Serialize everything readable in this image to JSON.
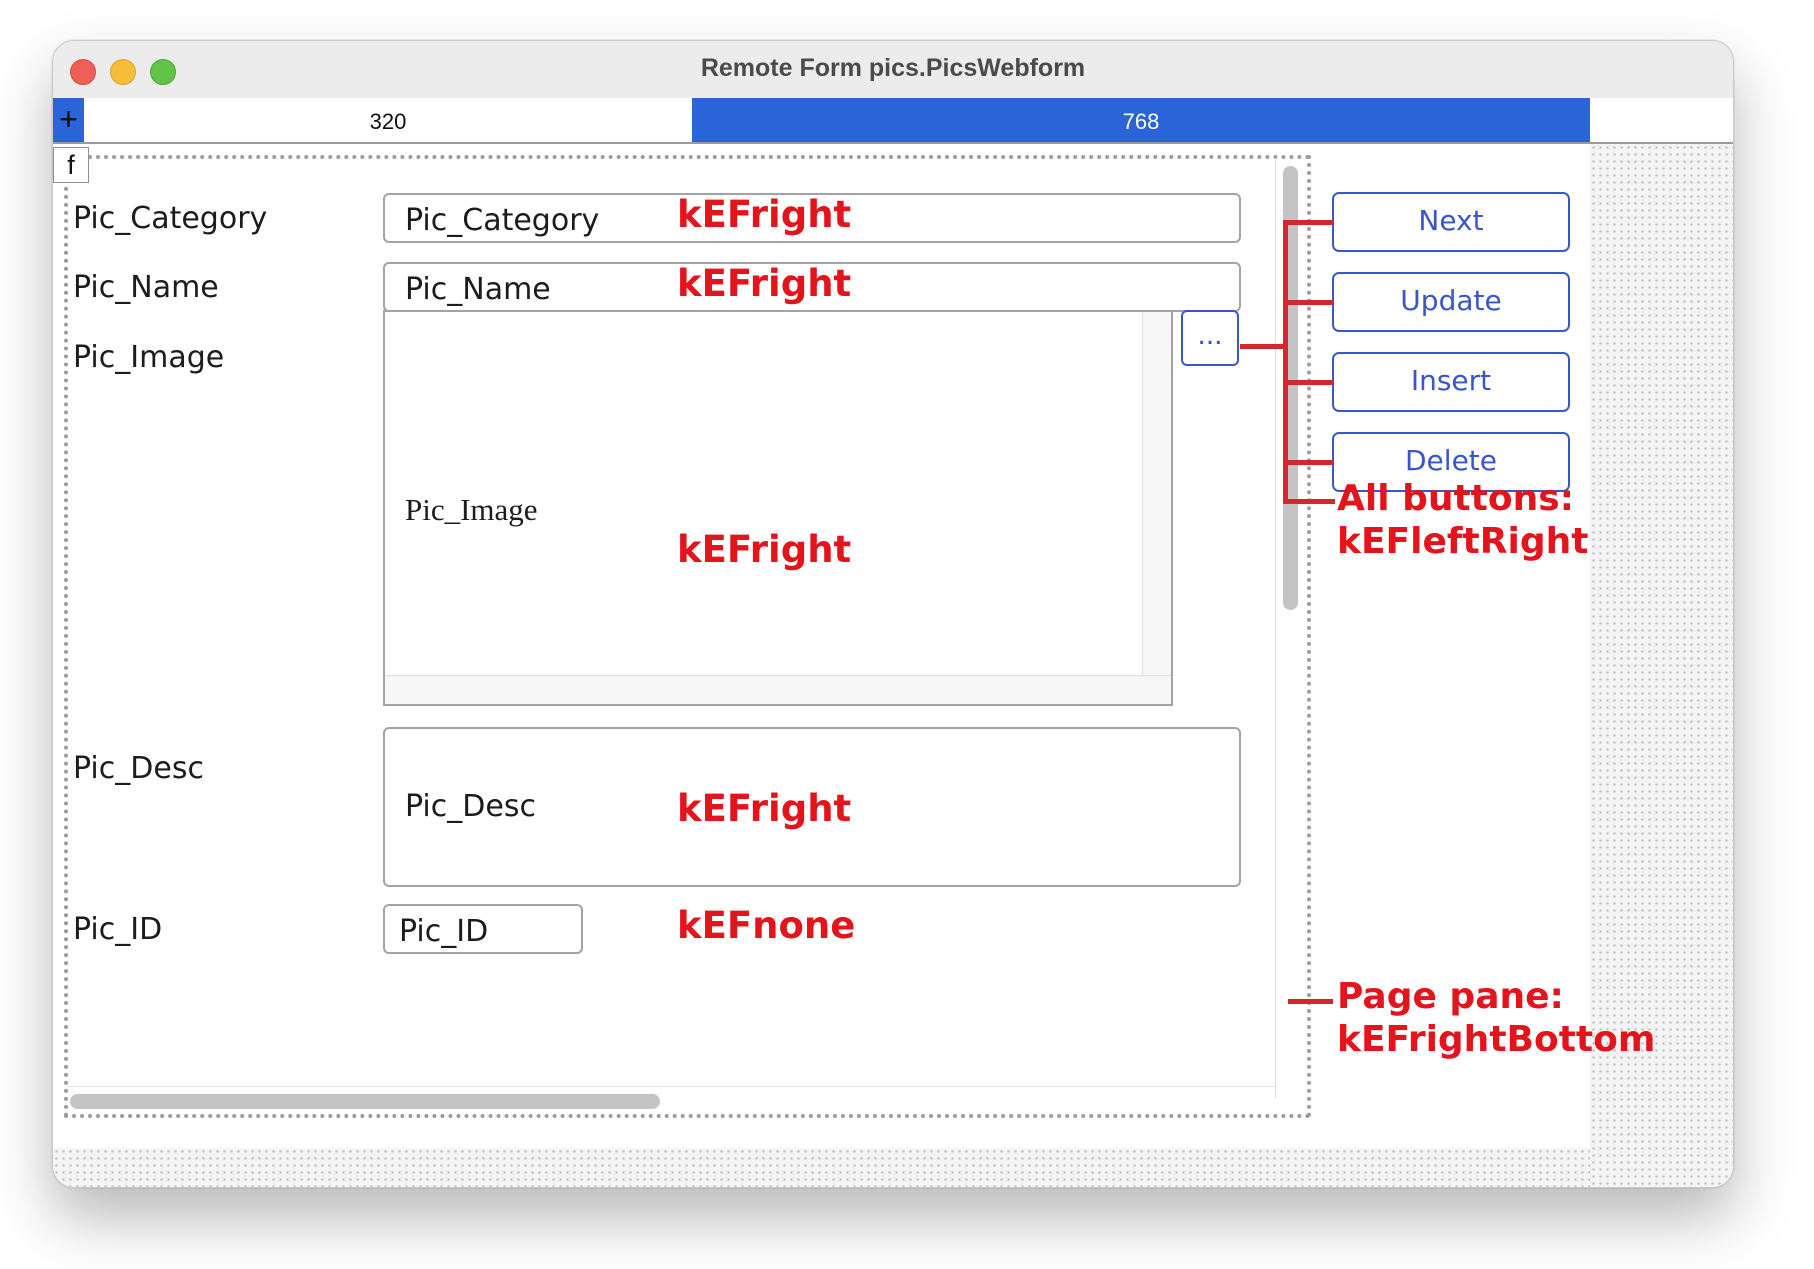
{
  "window": {
    "title": "Remote Form pics.PicsWebform"
  },
  "breakpoints": {
    "plus_label": "+",
    "items": [
      "320",
      "768"
    ]
  },
  "form": {
    "f_label": "f",
    "fields": [
      {
        "label": "Pic_Category",
        "value": "Pic_Category",
        "anchor": "kEFright"
      },
      {
        "label": "Pic_Name",
        "value": "Pic_Name",
        "anchor": "kEFright"
      },
      {
        "label": "Pic_Image",
        "value": "Pic_Image",
        "anchor": "kEFright",
        "button": "..."
      },
      {
        "label": "Pic_Desc",
        "value": "Pic_Desc",
        "anchor": "kEFright"
      },
      {
        "label": "Pic_ID",
        "value": "Pic_ID",
        "anchor": "kEFnone"
      }
    ]
  },
  "buttons": [
    "Next",
    "Update",
    "Insert",
    "Delete"
  ],
  "annotations": {
    "buttons_line1": "All buttons:",
    "buttons_line2": "kEFleftRight",
    "pane_line1": "Page pane:",
    "pane_line2": "kEFrightBottom"
  },
  "colors": {
    "annotation": "#e3141b",
    "accent": "#2b63d9",
    "button": "#3a56c9"
  }
}
